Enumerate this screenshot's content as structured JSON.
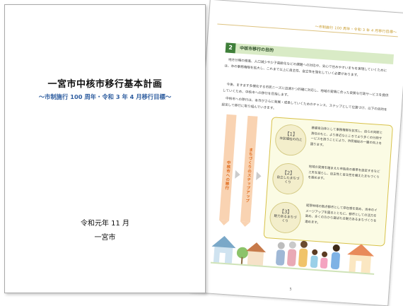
{
  "cover": {
    "title": "一宮市中核市移行基本計画",
    "subtitle": "～市制施行 100 周年・令和 3 年 4 月移行目標～",
    "date": "令和元年 11 月",
    "org": "一宮市"
  },
  "inner": {
    "running_header": "～市制施行 100 周年・令和 3 年 4 月移行目標～",
    "section_number": "2",
    "section_title": "中核市移行の目的",
    "paragraphs": [
      "地方分権の推進、人口減少や少子高齢化などの課題への対応や、安心で住みやすいまちを実現していくためには、市の事務権限を拡大し、これまで以上に自主性、自立性を強化していく必要があります。",
      "今後、ますます多様化する市民ニーズに迅速かつ的確に対応し、地域の実情に合った良質な行政サービスを提供していくため、中核市への移行を目指します。",
      "中核市への移行は、本市がさらに発展・成長していくためのチャンス、ステップとして位置づけ、以下の目的を設定して移行に取り組んでいきます。"
    ],
    "flow_labels": [
      "中核市への移行",
      "まちづくりのステップアップ"
    ],
    "goals": [
      {
        "number": "【1】",
        "label": "市民福祉の向上",
        "text": "基礎自治体として事務権限を拡充し、自らの判断と責任のもと、より身近なところでより多くの行政サービスを担うことにより、市民福祉の一層の向上を図ります。"
      },
      {
        "number": "【2】",
        "label": "自立したまちづくり",
        "text": "地域の実情を踏まえた市独自の基準を設定するなど工夫を凝らし、自主性と自立性を備えたまちづくりを進めます。"
      },
      {
        "number": "【3】",
        "label": "魅力あるまちづくり",
        "text": "尾張地域の拠点都市として存在感を高め、当市のイメージアップを図るとともに、都市としての活力を高め、多くの方から選ばれる魅力あるまちづくりを進めます。"
      }
    ],
    "page_number": "5"
  },
  "colors": {
    "section_green": "#3f7f3a",
    "section_bar": "#d9ebc6",
    "accent_orange": "#e06a1b",
    "flow_fill": "#f9d3b2",
    "subtitle_blue": "#2f5ea0",
    "goals_border": "#d8c24a"
  }
}
